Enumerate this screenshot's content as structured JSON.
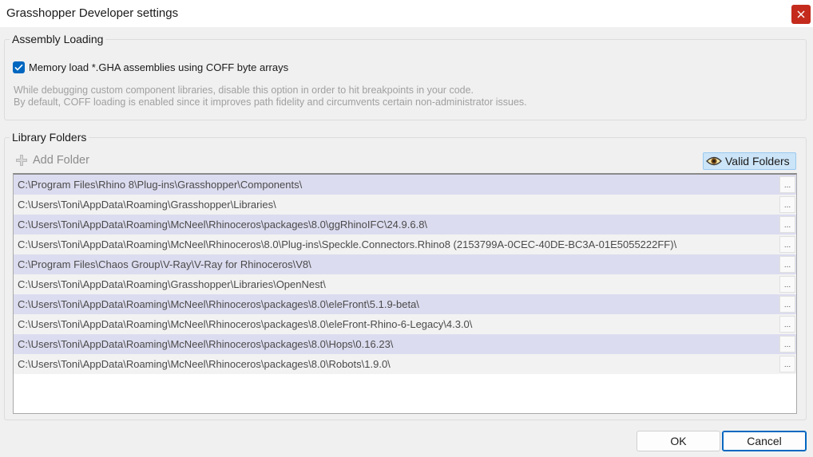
{
  "window": {
    "title": "Grasshopper Developer settings"
  },
  "assembly_loading": {
    "legend": "Assembly Loading",
    "checkbox_label": "Memory load *.GHA assemblies using COFF byte arrays",
    "checked": true,
    "help_line1": "While debugging custom component libraries, disable this option in order to hit breakpoints in your code.",
    "help_line2": "By default, COFF loading is enabled since it improves path fidelity and circumvents certain non-administrator issues."
  },
  "library_folders": {
    "legend": "Library Folders",
    "add_folder_label": "Add Folder",
    "valid_folders_label": "Valid Folders",
    "browse_label": "...",
    "folders": [
      "C:\\Program Files\\Rhino 8\\Plug-ins\\Grasshopper\\Components\\",
      "C:\\Users\\Toni\\AppData\\Roaming\\Grasshopper\\Libraries\\",
      "C:\\Users\\Toni\\AppData\\Roaming\\McNeel\\Rhinoceros\\packages\\8.0\\ggRhinoIFC\\24.9.6.8\\",
      "C:\\Users\\Toni\\AppData\\Roaming\\McNeel\\Rhinoceros\\8.0\\Plug-ins\\Speckle.Connectors.Rhino8 (2153799A-0CEC-40DE-BC3A-01E5055222FF)\\",
      "C:\\Program Files\\Chaos Group\\V-Ray\\V-Ray for Rhinoceros\\V8\\",
      "C:\\Users\\Toni\\AppData\\Roaming\\Grasshopper\\Libraries\\OpenNest\\",
      "C:\\Users\\Toni\\AppData\\Roaming\\McNeel\\Rhinoceros\\packages\\8.0\\eleFront\\5.1.9-beta\\",
      "C:\\Users\\Toni\\AppData\\Roaming\\McNeel\\Rhinoceros\\packages\\8.0\\eleFront-Rhino-6-Legacy\\4.3.0\\",
      "C:\\Users\\Toni\\AppData\\Roaming\\McNeel\\Rhinoceros\\packages\\8.0\\Hops\\0.16.23\\",
      "C:\\Users\\Toni\\AppData\\Roaming\\McNeel\\Rhinoceros\\packages\\8.0\\Robots\\1.9.0\\"
    ]
  },
  "buttons": {
    "ok_label": "OK",
    "cancel_label": "Cancel"
  },
  "colors": {
    "accent": "#0067c0",
    "close": "#c42b1c",
    "row_highlight": "#dcdcf0",
    "valid_folders_bg": "#cce4f7"
  },
  "icons": {
    "close": "close-icon",
    "check": "checkmark-icon",
    "add": "plus-icon",
    "valid": "eye-icon"
  }
}
